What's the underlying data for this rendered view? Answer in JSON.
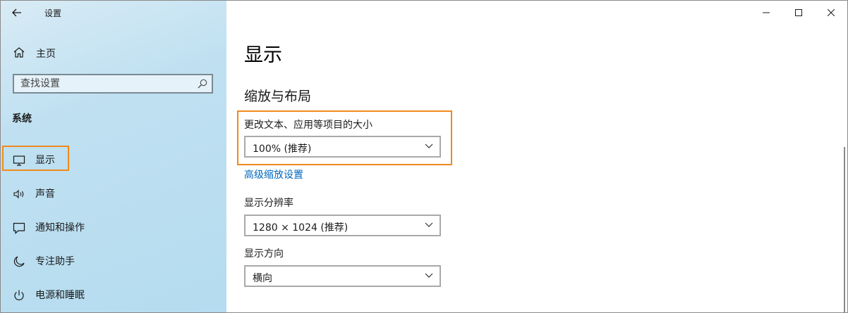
{
  "window": {
    "title": "设置"
  },
  "sidebar": {
    "home_label": "主页",
    "search_placeholder": "查找设置",
    "section_label": "系统",
    "items": [
      {
        "label": "显示",
        "icon": "monitor-icon",
        "selected": true
      },
      {
        "label": "声音",
        "icon": "speaker-icon",
        "selected": false
      },
      {
        "label": "通知和操作",
        "icon": "notification-icon",
        "selected": false
      },
      {
        "label": "专注助手",
        "icon": "moon-icon",
        "selected": false
      },
      {
        "label": "电源和睡眠",
        "icon": "power-icon",
        "selected": false
      }
    ]
  },
  "main": {
    "page_title": "显示",
    "scale_section": {
      "title": "缩放与布局",
      "text_size_label": "更改文本、应用等项目的大小",
      "text_size_value": "100% (推荐)",
      "advanced_link": "高级缩放设置"
    },
    "resolution": {
      "label": "显示分辨率",
      "value": "1280 × 1024 (推荐)"
    },
    "orientation": {
      "label": "显示方向",
      "value": "横向"
    }
  },
  "colors": {
    "highlight": "#f08a1c",
    "link": "#0067c0",
    "sidebar_bg": "#bfe0f1"
  }
}
